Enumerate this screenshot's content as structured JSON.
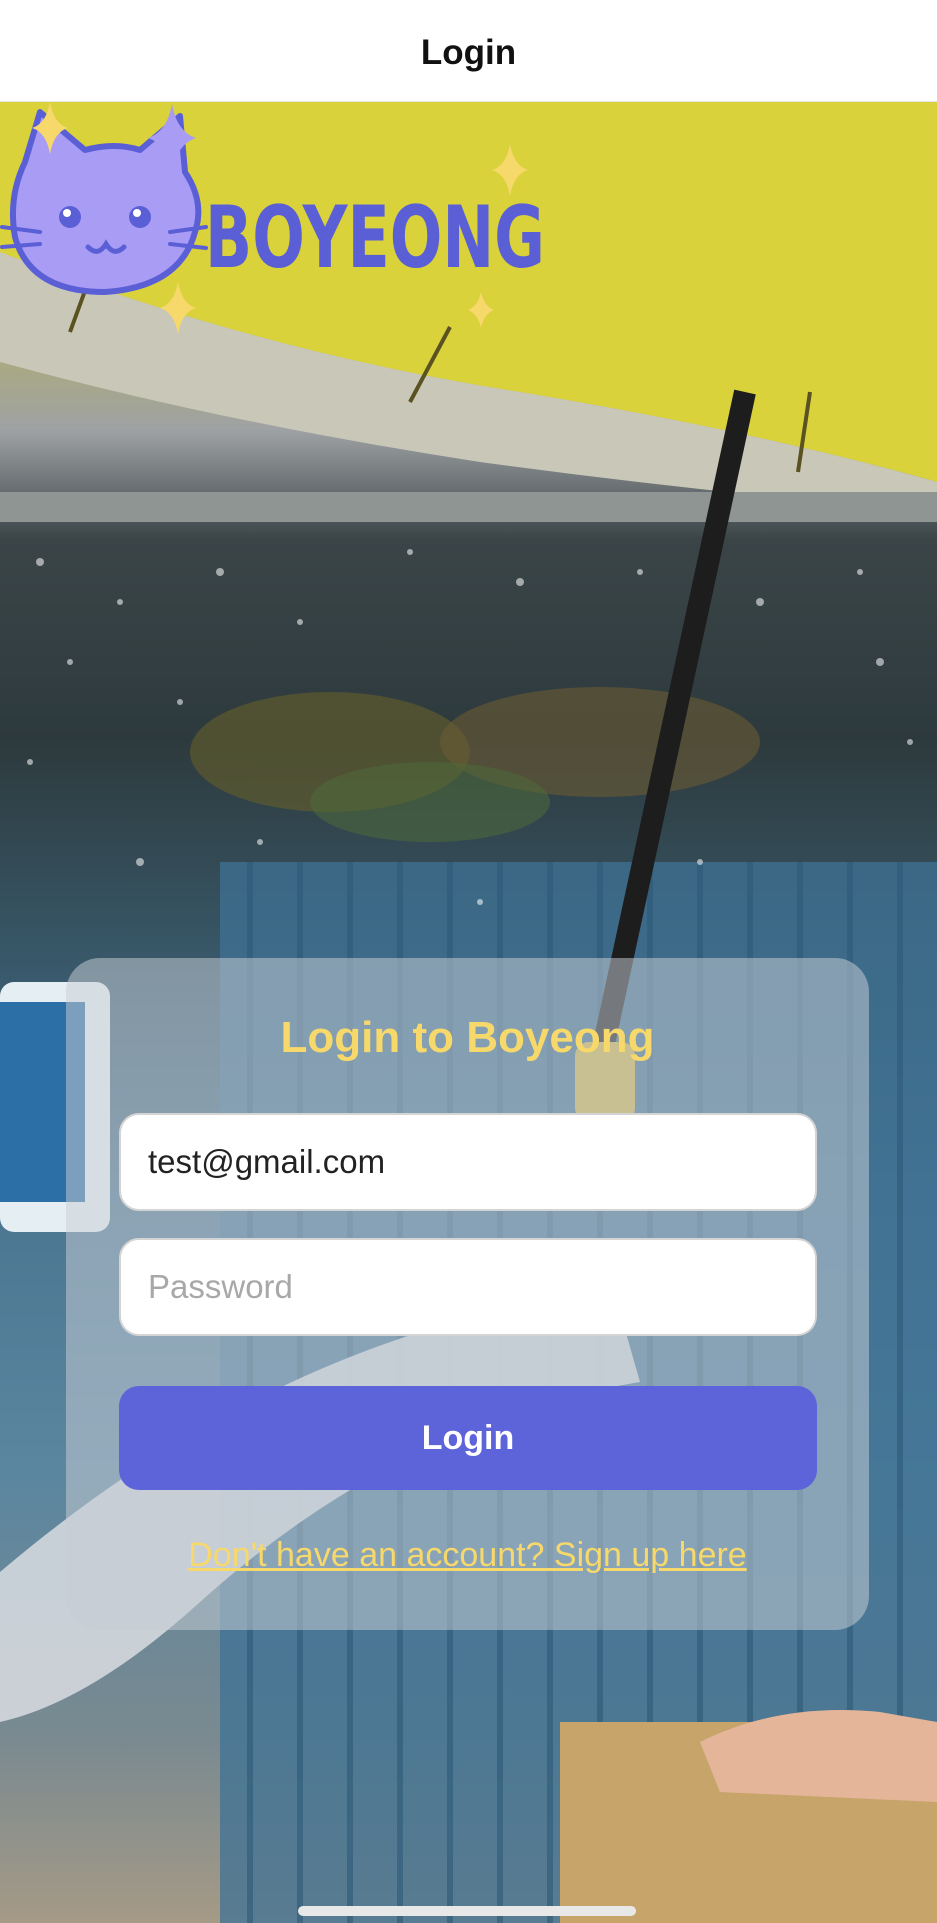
{
  "nav": {
    "title": "Login"
  },
  "logo": {
    "brand_text": "BOYEONG"
  },
  "form": {
    "title": "Login to Boyeong",
    "email_value": "test@gmail.com",
    "password_placeholder": "Password",
    "login_label": "Login",
    "signup_link": "Don't have an account? Sign up here"
  },
  "colors": {
    "accent": "#5d63d9",
    "highlight": "#f7d86a",
    "logo_purple": "#a89cf5",
    "logo_outline": "#5b5fd6"
  },
  "icons": [
    "cat-icon",
    "sparkle-icon"
  ]
}
